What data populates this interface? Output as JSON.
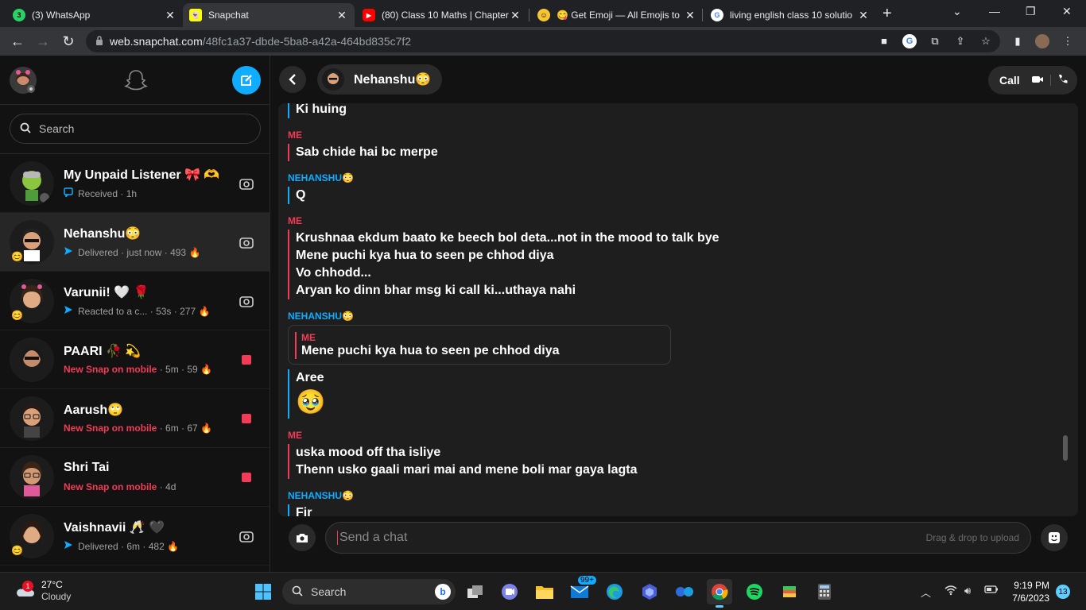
{
  "browser": {
    "tabs": [
      {
        "title": "(3) WhatsApp",
        "icon": "whatsapp-icon",
        "badge": "3"
      },
      {
        "title": "Snapchat",
        "icon": "snapchat-icon"
      },
      {
        "title": "(80) Class 10 Maths | Chapter",
        "icon": "youtube-icon"
      },
      {
        "title": "😋 Get Emoji — All Emojis to",
        "icon": "emoji-icon"
      },
      {
        "title": "living english class 10 solutio",
        "icon": "google-icon"
      }
    ],
    "url_host": "web.snapchat.com",
    "url_path": "/48fc1a37-dbde-5ba8-a42a-464bd835c7f2"
  },
  "sidebar": {
    "search_placeholder": "Search",
    "chats": [
      {
        "name": "My Unpaid Listener 🎀 🫶",
        "status": "Received",
        "time": "1h",
        "streak": "",
        "status_type": "received",
        "right": "camera"
      },
      {
        "name": "Nehanshu😳",
        "status": "Delivered",
        "time": "just now",
        "streak": "493",
        "status_type": "delivered",
        "right": "camera"
      },
      {
        "name": "Varunii! 🤍 🌹",
        "status": "Reacted to a c...",
        "time": "53s",
        "streak": "277",
        "status_type": "delivered",
        "right": "camera"
      },
      {
        "name": "PAARI 🥀 💫",
        "status": "New Snap on mobile",
        "time": "5m",
        "streak": "59",
        "status_type": "new",
        "right": "snap"
      },
      {
        "name": "Aarush🙄",
        "status": "New Snap on mobile",
        "time": "6m",
        "streak": "67",
        "status_type": "new",
        "right": "snap"
      },
      {
        "name": "Shri Tai",
        "status": "New Snap on mobile",
        "time": "4d",
        "streak": "",
        "status_type": "new",
        "right": "snap"
      },
      {
        "name": "Vaishnavii 🥂 🖤",
        "status": "Delivered",
        "time": "6m",
        "streak": "482",
        "status_type": "delivered",
        "right": "camera"
      }
    ]
  },
  "conversation": {
    "friend_name": "Nehanshu😳",
    "call_label": "Call",
    "messages": [
      {
        "sender": "",
        "side": "nh",
        "lines": [
          "Ki huing"
        ]
      },
      {
        "sender": "ME",
        "side": "me",
        "lines": [
          "Sab chide hai bc merpe"
        ]
      },
      {
        "sender": "NEHANSHU😳",
        "side": "nh",
        "lines": [
          "Q"
        ]
      },
      {
        "sender": "ME",
        "side": "me",
        "lines": [
          "Krushnaa ekdum baato ke beech bol deta...not in the mood to talk bye",
          "Mene puchi kya hua to seen pe chhod diya",
          "Vo chhodd...",
          "Aryan ko dinn bhar msg ki call ki...uthaya nahi"
        ]
      },
      {
        "sender": "NEHANSHU😳",
        "side": "nh",
        "quote": {
          "sender": "ME",
          "text": "Mene puchi kya hua to seen pe chhod diya"
        },
        "lines": [
          "Aree",
          "🥹"
        ]
      },
      {
        "sender": "ME",
        "side": "me",
        "lines": [
          "uska mood off tha isliye",
          "Thenn usko gaali mari mai and mene boli mar gaya lagta"
        ]
      },
      {
        "sender": "NEHANSHU😳",
        "side": "nh",
        "lines": [
          "Fir"
        ]
      }
    ],
    "compose_placeholder": "Send a chat",
    "drag_drop_label": "Drag & drop to upload"
  },
  "taskbar": {
    "weather_temp": "27°C",
    "weather_desc": "Cloudy",
    "weather_badge": "1",
    "search_label": "Search",
    "mail_badge": "99+",
    "time": "9:19 PM",
    "date": "7/6/2023",
    "notifications": "13"
  },
  "colors": {
    "accent_blue": "#0fadff",
    "accent_red": "#f23c57",
    "background": "#121212"
  }
}
